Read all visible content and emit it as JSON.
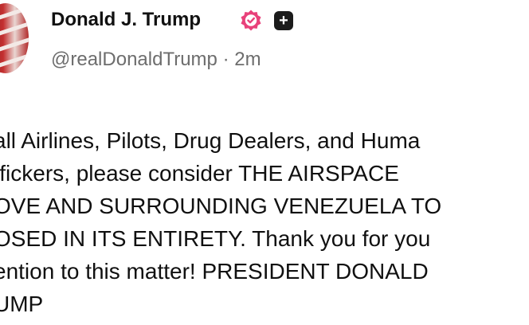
{
  "post": {
    "display_name": "Donald J. Trump",
    "handle": "@realDonaldTrump",
    "separator": "·",
    "timestamp": "2m",
    "icons": {
      "verified": "verified-badge-icon",
      "extra": "plus-icon"
    },
    "badge_color": "#e8417a",
    "body_lines": [
      "all Airlines, Pilots, Drug Dealers, and Huma",
      "ffickers, please consider THE AIRSPACE",
      "OVE AND SURROUNDING VENEZUELA TO",
      "OSED IN ITS ENTIRETY. Thank you for you",
      "ention to this matter! PRESIDENT DONALD",
      "UMP"
    ]
  }
}
